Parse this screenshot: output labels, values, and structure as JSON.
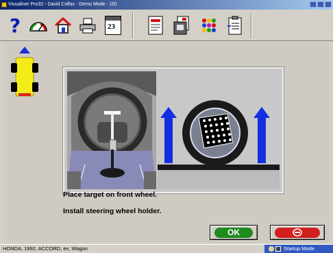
{
  "window": {
    "title": "Visualiner Pro32 - David Colfax - Demo Mode - 1ID"
  },
  "toolbar": {
    "icons": [
      "help-icon",
      "gauge-icon",
      "home-icon",
      "printer-icon",
      "calendar-icon",
      "checklist-icon",
      "document-icon",
      "color-dots-icon",
      "clipboard-icon"
    ],
    "calendar_label": "23"
  },
  "colors": {
    "ok_green": "#1f8a1f",
    "cancel_red": "#d21e1e",
    "arrow_blue": "#1230e0",
    "car_yellow": "#f4ec1a"
  },
  "instructions": {
    "line1": "Place target on front wheel.",
    "line2": "Install steering wheel holder."
  },
  "buttons": {
    "ok_label": "OK",
    "cancel_icon": "no-entry-icon"
  },
  "status": {
    "vehicle": "HONDA, 1992, ACCORD, ex, Wagon",
    "mode": "Startup Mode"
  }
}
